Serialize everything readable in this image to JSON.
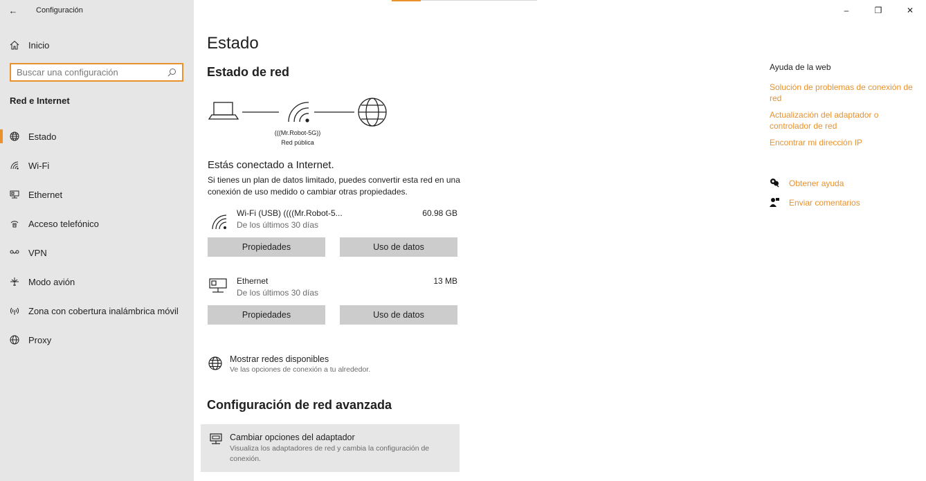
{
  "window": {
    "title": "Configuración",
    "controls": {
      "minimize": "–",
      "maximize": "❐",
      "close": "✕"
    }
  },
  "sidebar": {
    "home_label": "Inicio",
    "search_placeholder": "Buscar una configuración",
    "section_title": "Red e Internet",
    "items": [
      {
        "label": "Estado",
        "icon": "globe-status-icon",
        "active": true
      },
      {
        "label": "Wi-Fi",
        "icon": "wifi-icon",
        "active": false
      },
      {
        "label": "Ethernet",
        "icon": "ethernet-icon",
        "active": false
      },
      {
        "label": "Acceso telefónico",
        "icon": "dialup-icon",
        "active": false
      },
      {
        "label": "VPN",
        "icon": "vpn-icon",
        "active": false
      },
      {
        "label": "Modo avión",
        "icon": "airplane-icon",
        "active": false
      },
      {
        "label": "Zona con cobertura inalámbrica móvil",
        "icon": "hotspot-icon",
        "active": false
      },
      {
        "label": "Proxy",
        "icon": "globe-icon",
        "active": false
      }
    ]
  },
  "main": {
    "page_title": "Estado",
    "network_status_title": "Estado de red",
    "diagram": {
      "network_name": "(((Mr.Robot-5G))",
      "network_type": "Red pública"
    },
    "connected_title": "Estás conectado a Internet.",
    "connected_desc": "Si tienes un plan de datos limitado, puedes convertir esta red en una conexión de uso medido o cambiar otras propiedades.",
    "adapters": [
      {
        "name": "Wi-Fi (USB) ((((Mr.Robot-5...",
        "period": "De los últimos 30 días",
        "usage": "60.98 GB",
        "properties_label": "Propiedades",
        "data_usage_label": "Uso de datos"
      },
      {
        "name": "Ethernet",
        "period": "De los últimos 30 días",
        "usage": "13 MB",
        "properties_label": "Propiedades",
        "data_usage_label": "Uso de datos"
      }
    ],
    "show_networks": {
      "title": "Mostrar redes disponibles",
      "desc": "Ve las opciones de conexión a tu alrededor."
    },
    "advanced_title": "Configuración de red avanzada",
    "adapter_options": {
      "title": "Cambiar opciones del adaptador",
      "desc": "Visualiza los adaptadores de red y cambia la configuración de conexión."
    }
  },
  "right": {
    "web_help_title": "Ayuda de la web",
    "links": [
      "Solución de problemas de conexión de red",
      "Actualización del adaptador o controlador de red",
      "Encontrar mi dirección IP"
    ],
    "get_help": "Obtener ayuda",
    "feedback": "Enviar comentarios"
  },
  "colors": {
    "accent": "#e8912d",
    "sidebar_bg": "#e6e6e6",
    "button_bg": "#cccccc"
  }
}
